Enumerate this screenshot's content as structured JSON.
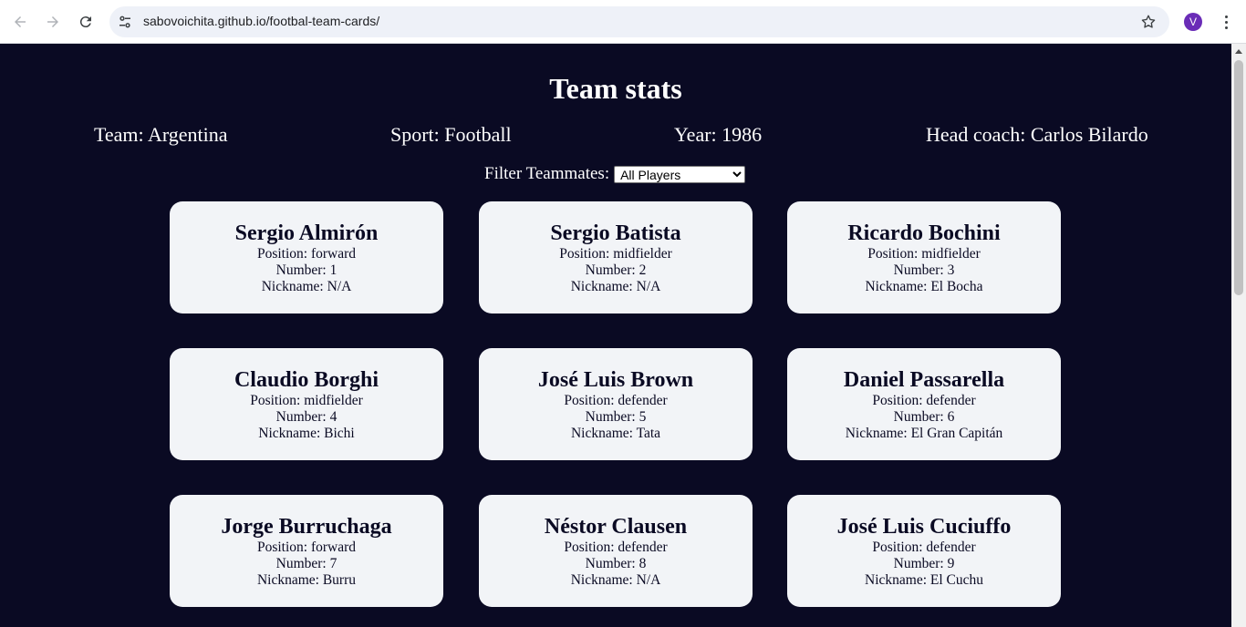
{
  "browser": {
    "url": "sabovoichita.github.io/footbal-team-cards/",
    "profile_initial": "V"
  },
  "page": {
    "title": "Team stats",
    "team": "Team: Argentina",
    "sport": "Sport: Football",
    "year": "Year: 1986",
    "coach": "Head coach: Carlos Bilardo",
    "filter_label": "Filter Teammates:",
    "filter_selected": "All Players"
  },
  "players": [
    {
      "name": "Sergio Almirón",
      "position": "Position: forward",
      "number": "Number: 1",
      "nickname": "Nickname: N/A"
    },
    {
      "name": "Sergio Batista",
      "position": "Position: midfielder",
      "number": "Number: 2",
      "nickname": "Nickname: N/A"
    },
    {
      "name": "Ricardo Bochini",
      "position": "Position: midfielder",
      "number": "Number: 3",
      "nickname": "Nickname: El Bocha"
    },
    {
      "name": "Claudio Borghi",
      "position": "Position: midfielder",
      "number": "Number: 4",
      "nickname": "Nickname: Bichi"
    },
    {
      "name": "José Luis Brown",
      "position": "Position: defender",
      "number": "Number: 5",
      "nickname": "Nickname: Tata"
    },
    {
      "name": "Daniel Passarella",
      "position": "Position: defender",
      "number": "Number: 6",
      "nickname": "Nickname: El Gran Capitán"
    },
    {
      "name": "Jorge Burruchaga",
      "position": "Position: forward",
      "number": "Number: 7",
      "nickname": "Nickname: Burru"
    },
    {
      "name": "Néstor Clausen",
      "position": "Position: defender",
      "number": "Number: 8",
      "nickname": "Nickname: N/A"
    },
    {
      "name": "José Luis Cuciuffo",
      "position": "Position: defender",
      "number": "Number: 9",
      "nickname": "Nickname: El Cuchu"
    }
  ]
}
